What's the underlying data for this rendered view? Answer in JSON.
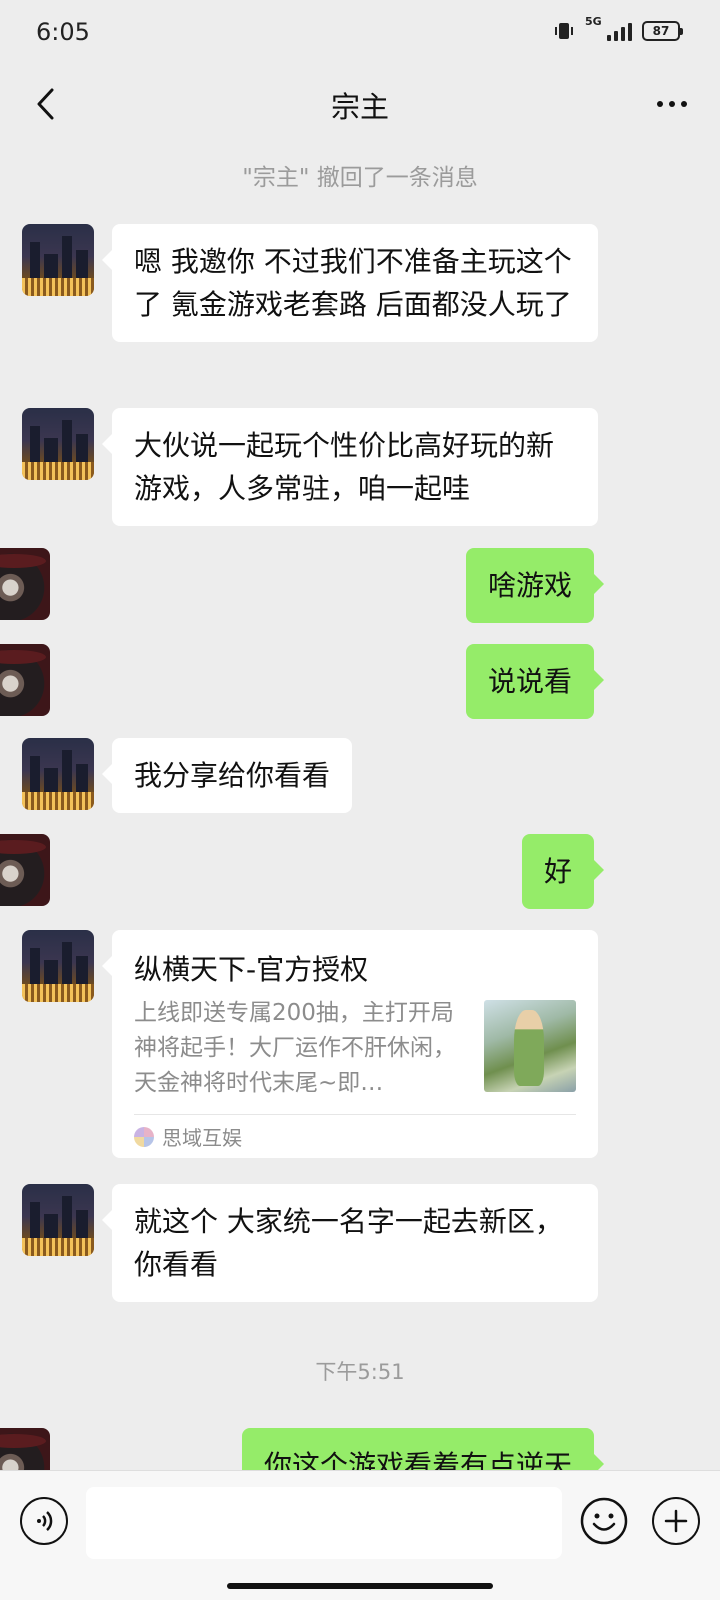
{
  "status_bar": {
    "time": "6:05",
    "network": "5G",
    "battery": "87"
  },
  "header": {
    "title": "宗主"
  },
  "system_message": "\"宗主\" 撤回了一条消息",
  "messages": [
    {
      "text": "嗯 我邀你 不过我们不准备主玩这个了 氪金游戏老套路 后面都没人玩了"
    },
    {
      "text": "大伙说一起玩个性价比高好玩的新游戏，人多常驻，咱一起哇"
    },
    {
      "text": "啥游戏"
    },
    {
      "text": "说说看"
    },
    {
      "text": "我分享给你看看"
    },
    {
      "text": "好"
    },
    {
      "text": "就这个 大家统一名字一起去新区，你看看"
    },
    {
      "text": "你这个游戏看着有点逆天"
    }
  ],
  "link_card": {
    "title": "纵横天下-官方授权",
    "description": "上线即送专属200抽，主打开局神将起手！大厂运作不肝休闲，天金神将时代末尾~即…",
    "source": "思域互娱"
  },
  "timestamp": "下午5:51",
  "colors": {
    "sent_bubble": "#95ec69",
    "received_bubble": "#ffffff",
    "background": "#ededed"
  },
  "icons": {
    "back": "chevron-left-icon",
    "more": "more-dots-icon",
    "voice": "voice-icon",
    "emoji": "emoji-icon",
    "plus": "plus-icon"
  }
}
